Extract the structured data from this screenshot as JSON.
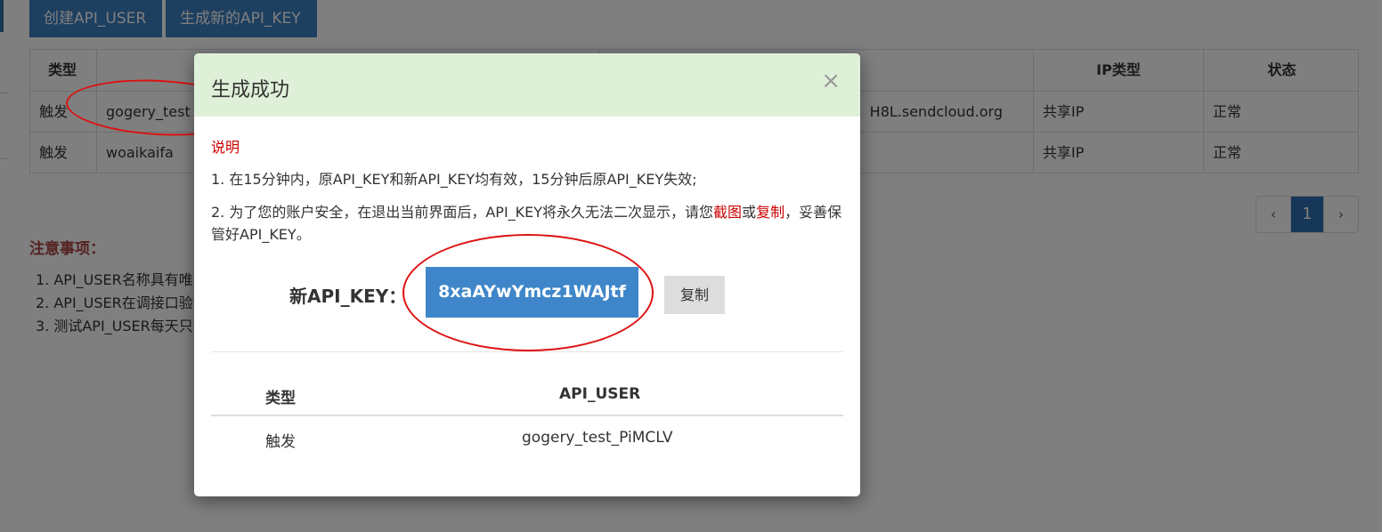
{
  "toolbar": {
    "create_label": "创建API_USER",
    "generate_label": "生成新的API_KEY"
  },
  "table": {
    "headers": [
      "类型",
      "",
      "",
      "IP类型",
      "状态"
    ],
    "rows": [
      [
        "触发",
        "gogery_test",
        "H8L.sendcloud.org",
        "共享IP",
        "正常"
      ],
      [
        "触发",
        "woaikaifa",
        "",
        "共享IP",
        "正常"
      ]
    ]
  },
  "pagination": {
    "prev": "‹",
    "current": "1",
    "next": "›"
  },
  "notice": {
    "title": "注意事项：",
    "items": [
      "1. API_USER名称具有唯",
      "2. API_USER在调接口验",
      "3. 测试API_USER每天只"
    ]
  },
  "modal": {
    "title": "生成成功",
    "close": "×",
    "note_title": "说明",
    "note1": "1. 在15分钟内，原API_KEY和新API_KEY均有效，15分钟后原API_KEY失效;",
    "note2_a": "2. 为了您的账户安全，在退出当前界面后，API_KEY将永久无法二次显示，请您",
    "note2_b": "截图",
    "note2_c": "或",
    "note2_d": "复制",
    "note2_e": "，妥善保管好API_KEY。",
    "key_label": "新API_KEY：",
    "key_value": "8xaAYwYmcz1WAJtf",
    "copy_label": "复制",
    "result_headers": [
      "类型",
      "API_USER"
    ],
    "result_row": [
      "触发",
      "gogery_test_PiMCLV"
    ]
  },
  "colors": {
    "primary": "#3a7fc0",
    "success_bg": "#dff0d8",
    "danger": "#cc0000"
  }
}
